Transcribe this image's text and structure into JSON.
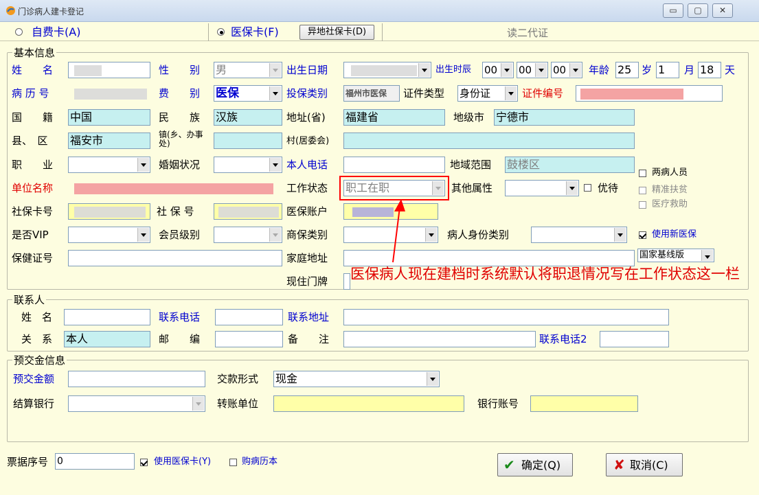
{
  "window": {
    "title": "门诊病人建卡登记",
    "min": "▭",
    "max": "▢",
    "close": "✕"
  },
  "card_bar": {
    "self_pay": "自费卡(A)",
    "medical": "医保卡(F)",
    "remote": "异地社保卡(D)",
    "read_id": "读二代证"
  },
  "basic": {
    "group_title": "基本信息",
    "name_label": "姓　　名",
    "sex_label": "性　　别",
    "sex_value": "男",
    "dob_label": "出生日期",
    "birth_time_label": "出生时辰",
    "hh": "00",
    "mm": "00",
    "ss": "00",
    "age_label": "年龄",
    "age": "25",
    "year_unit": "岁",
    "month": "1",
    "month_unit": "月",
    "day": "18",
    "day_unit": "天",
    "record_label": "病 历 号",
    "fee_label": "费　　别",
    "fee_value": "医保",
    "insure_label": "投保类别",
    "insure_value": "福州市医保",
    "id_type_label": "证件类型",
    "id_type_value": "身份证",
    "id_no_label": "证件编号",
    "nation_label": "国　　籍",
    "nation_value": "中国",
    "ethnic_label": "民　　族",
    "ethnic_value": "汉族",
    "province_label": "地址(省)",
    "province_value": "福建省",
    "city_label": "地级市",
    "city_value": "宁德市",
    "county_label": "县、　区",
    "county_value": "福安市",
    "town_label": "镇(乡、办事处)",
    "village_label": "村(居委会)",
    "job_label": "职　　业",
    "marital_label": "婚姻状况",
    "phone_label": "本人电话",
    "region_label": "地域范围",
    "region_value": "鼓楼区",
    "two_disease": "两病人员",
    "employer_label": "单位名称",
    "work_status_label": "工作状态",
    "work_status_value": "职工在职",
    "other_attr_label": "其他属性",
    "priority": "优待",
    "poverty": "精准扶贫",
    "med_aid": "医疗救助",
    "sscard_label": "社保卡号",
    "ssno_label": "社 保 号",
    "med_acct_label": "医保账户",
    "vip_label": "是否VIP",
    "member_label": "会员级别",
    "comm_ins_label": "商保类别",
    "identity_label": "病人身份类别",
    "use_new_med": "使用新医保",
    "health_no_label": "保健证号",
    "home_addr_label": "家庭地址",
    "national_base": "国家基线版",
    "current_door_label": "现住门牌"
  },
  "annotation": "医保病人现在建档时系统默认将职退情况写在工作状态这一栏",
  "contact": {
    "group_title": "联系人",
    "name_label": "姓　名",
    "phone_label": "联系电话",
    "addr_label": "联系地址",
    "relation_label": "关　系",
    "relation_value": "本人",
    "post_label": "邮　　编",
    "note_label": "备　　注",
    "phone2_label": "联系电话2"
  },
  "deposit": {
    "group_title": "预交金信息",
    "amount_label": "预交金额",
    "pay_method_label": "交款形式",
    "pay_method_value": "现金",
    "bank_label": "结算银行",
    "transfer_label": "转账单位",
    "account_label": "银行账号"
  },
  "footer": {
    "receipt_label": "票据序号",
    "receipt_value": "0",
    "use_med_card": "使用医保卡(Y)",
    "buy_book": "购病历本",
    "ok": "确定(Q)",
    "cancel": "取消(C)"
  }
}
